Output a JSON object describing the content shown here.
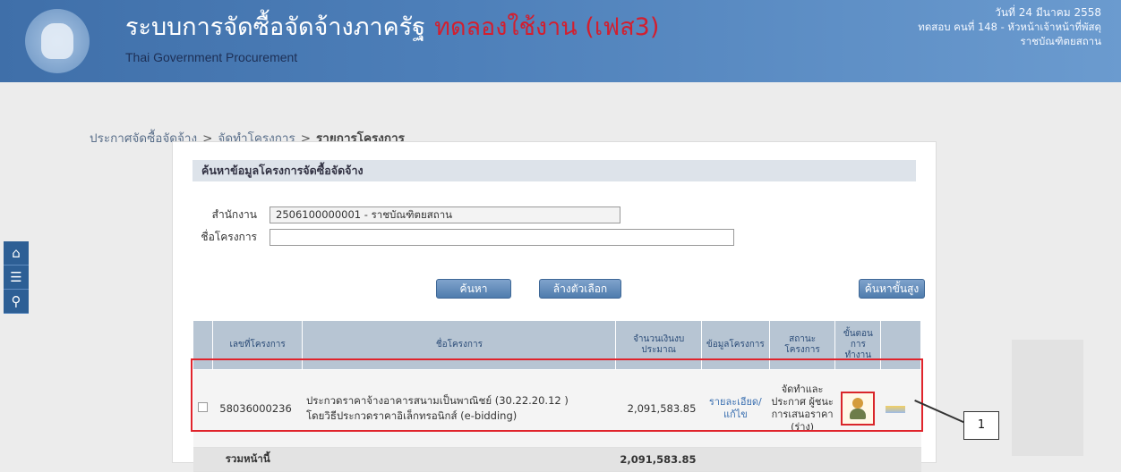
{
  "header": {
    "title": "ระบบการจัดซื้อจัดจ้างภาครัฐ",
    "title_trial": "ทดลองใช้งาน (เฟส3)",
    "subtitle": "Thai Government Procurement",
    "date": "วันที่ 24 มีนาคม 2558",
    "user": "ทดสอบ คนที่ 148 - หัวหน้าเจ้าหน้าที่พัสดุ",
    "unit": "ราชบัณฑิตยสถาน"
  },
  "sidenav": {
    "items": [
      "home-icon",
      "menu-icon",
      "search-icon"
    ]
  },
  "breadcrumb": {
    "items": [
      "ประกาศจัดซื้อจัดจ้าง",
      "จัดทำโครงการ",
      "รายการโครงการ"
    ],
    "separator": ">"
  },
  "search": {
    "title": "ค้นหาข้อมูลโครงการจัดซื้อจัดจ้าง",
    "agency_label": "สำนักงาน",
    "agency_value": "2506100000001 - ราชบัณฑิตยสถาน",
    "project_label": "ชื่อโครงการ",
    "project_value": "",
    "search_button": "ค้นหา",
    "clear_button": "ล้างตัวเลือก",
    "advanced_button": "ค้นหาขั้นสูง"
  },
  "table": {
    "headers": [
      "เลขที่โครงการ",
      "ชื่อโครงการ",
      "จำนวนเงินงบประมาณ",
      "ข้อมูลโครงการ",
      "สถานะโครงการ",
      "ขั้นตอนการทำงาน"
    ],
    "rows": [
      {
        "id": "58036000236",
        "name_line1": "ประกวดราคาจ้างอาคารสนามเป็นพาณิชย์ (30.22.20.12 )",
        "name_line2": "โดยวิธีประกวดราคาอิเล็กทรอนิกส์ (e-bidding)",
        "amount": "2,091,583.85",
        "info": "รายละเอียด/แก้ไข",
        "status": "จัดทำและประกาศ ผู้ชนะการเสนอราคา (ร่าง)"
      }
    ],
    "total_label": "รวมหน้านี้",
    "total_value": "2,091,583.85"
  },
  "annotation": {
    "callout": "1"
  }
}
